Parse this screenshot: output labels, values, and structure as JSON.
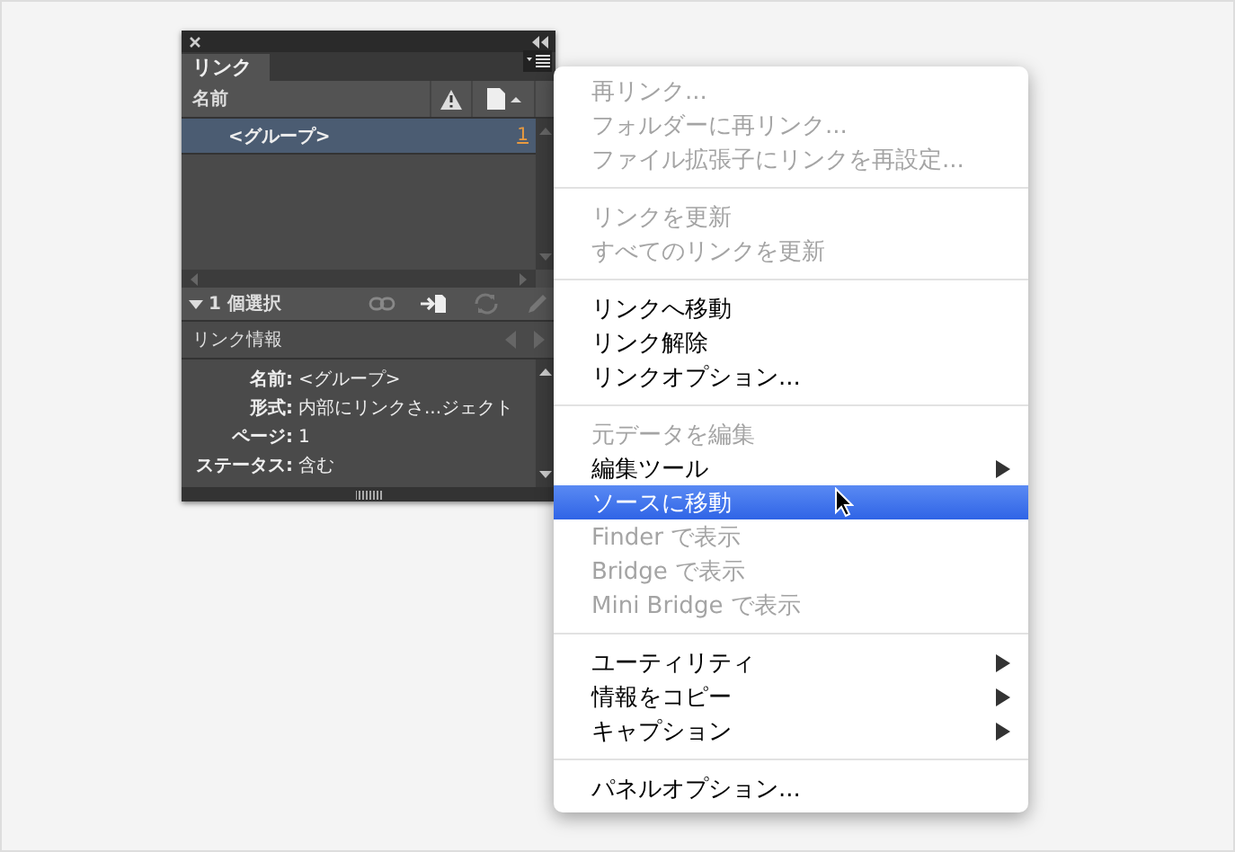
{
  "panel": {
    "tabs": [
      {
        "label": "リンク",
        "selected": true
      }
    ],
    "columns": [
      {
        "label": "名前"
      }
    ],
    "rows": [
      {
        "name": "<グループ>",
        "page": "1",
        "selected": true
      }
    ],
    "selection_count": "1 個選択",
    "info_title": "リンク情報",
    "info_fields": [
      {
        "label": "名前:",
        "value": "<グループ>"
      },
      {
        "label": "形式:",
        "value": "内部にリンクさ...ジェクト"
      },
      {
        "label": "ページ:",
        "value": "1"
      },
      {
        "label": "ステータス:",
        "value": "含む"
      }
    ]
  },
  "menu": {
    "groups": [
      [
        {
          "label": "再リンク...",
          "disabled": true,
          "submenu": false,
          "selected": false
        },
        {
          "label": "フォルダーに再リンク...",
          "disabled": true,
          "submenu": false,
          "selected": false
        },
        {
          "label": "ファイル拡張子にリンクを再設定...",
          "disabled": true,
          "submenu": false,
          "selected": false
        }
      ],
      [
        {
          "label": "リンクを更新",
          "disabled": true,
          "submenu": false,
          "selected": false
        },
        {
          "label": "すべてのリンクを更新",
          "disabled": true,
          "submenu": false,
          "selected": false
        }
      ],
      [
        {
          "label": "リンクへ移動",
          "disabled": false,
          "submenu": false,
          "selected": false
        },
        {
          "label": "リンク解除",
          "disabled": false,
          "submenu": false,
          "selected": false
        },
        {
          "label": "リンクオプション...",
          "disabled": false,
          "submenu": false,
          "selected": false
        }
      ],
      [
        {
          "label": "元データを編集",
          "disabled": true,
          "submenu": false,
          "selected": false
        },
        {
          "label": "編集ツール",
          "disabled": false,
          "submenu": true,
          "selected": false
        },
        {
          "label": "ソースに移動",
          "disabled": false,
          "submenu": false,
          "selected": true
        },
        {
          "label": "Finder で表示",
          "disabled": true,
          "submenu": false,
          "selected": false
        },
        {
          "label": "Bridge で表示",
          "disabled": true,
          "submenu": false,
          "selected": false
        },
        {
          "label": "Mini Bridge で表示",
          "disabled": true,
          "submenu": false,
          "selected": false
        }
      ],
      [
        {
          "label": "ユーティリティ",
          "disabled": false,
          "submenu": true,
          "selected": false
        },
        {
          "label": "情報をコピー",
          "disabled": false,
          "submenu": true,
          "selected": false
        },
        {
          "label": "キャプション",
          "disabled": false,
          "submenu": true,
          "selected": false
        }
      ],
      [
        {
          "label": "パネルオプション...",
          "disabled": false,
          "submenu": false,
          "selected": false
        }
      ]
    ]
  }
}
